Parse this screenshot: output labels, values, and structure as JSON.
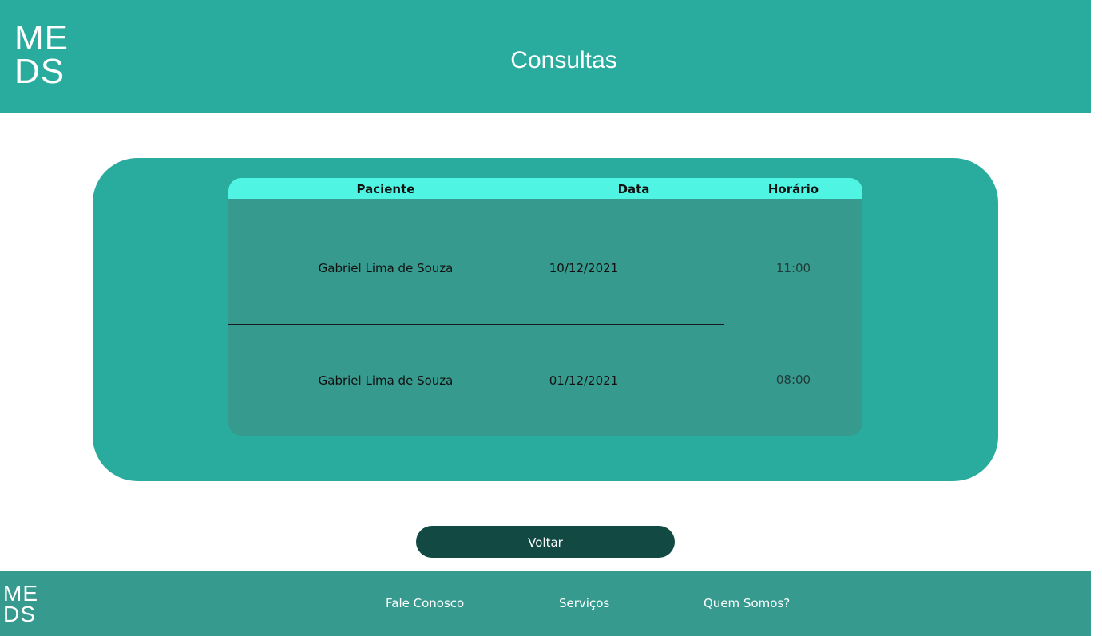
{
  "header": {
    "logo_line1": "ME",
    "logo_line2": "DS",
    "title": "Consultas"
  },
  "table": {
    "columns": [
      "Paciente",
      "Data",
      "Horário"
    ],
    "rows": [
      {
        "paciente": "Gabriel Lima de Souza",
        "data": "10/12/2021",
        "horario": "11:00"
      },
      {
        "paciente": "Gabriel Lima de Souza",
        "data": "01/12/2021",
        "horario": "08:00"
      }
    ]
  },
  "actions": {
    "back_label": "Voltar"
  },
  "footer": {
    "logo_line1": "ME",
    "logo_line2": "DS",
    "links": [
      "Fale Conosco",
      "Serviços",
      "Quem Somos?"
    ]
  },
  "colors": {
    "primary": "#29ac9e",
    "secondary": "#379a8e",
    "table_header": "#4ff4e2",
    "button": "#124a43"
  }
}
